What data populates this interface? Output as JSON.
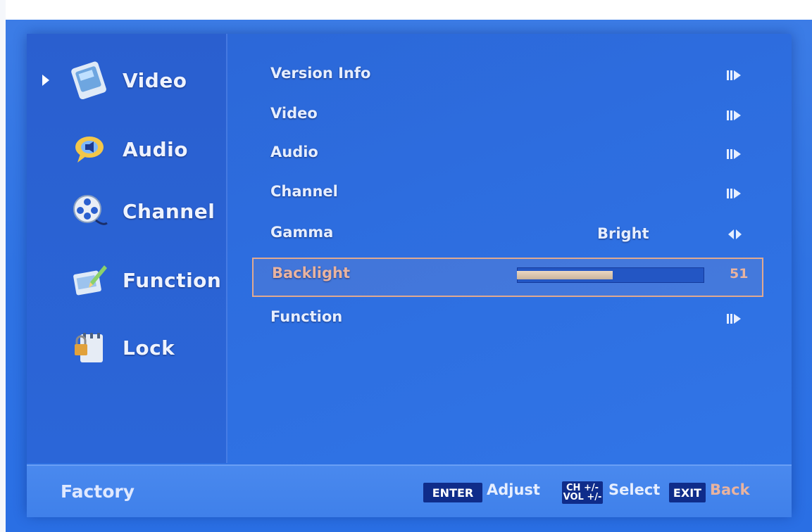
{
  "sidebar": {
    "items": [
      {
        "label": "Video",
        "icon": "video-icon",
        "selected": true
      },
      {
        "label": "Audio",
        "icon": "audio-icon",
        "selected": false
      },
      {
        "label": "Channel",
        "icon": "channel-icon",
        "selected": false
      },
      {
        "label": "Function",
        "icon": "function-icon",
        "selected": false
      },
      {
        "label": "Lock",
        "icon": "lock-icon",
        "selected": false
      }
    ]
  },
  "menu": {
    "items": [
      {
        "label": "Version Info",
        "value": "",
        "control": "submenu"
      },
      {
        "label": "Video",
        "value": "",
        "control": "submenu"
      },
      {
        "label": "Audio",
        "value": "",
        "control": "submenu"
      },
      {
        "label": "Channel",
        "value": "",
        "control": "submenu"
      },
      {
        "label": "Gamma",
        "value": "Bright",
        "control": "left-right"
      },
      {
        "label": "Backlight",
        "value": "51",
        "control": "slider",
        "level": 51,
        "max": 100
      },
      {
        "label": "Function",
        "value": "",
        "control": "submenu"
      }
    ],
    "selected_index": 5
  },
  "footer": {
    "title": "Factory",
    "keys": [
      {
        "key": "ENTER",
        "action": "Adjust"
      },
      {
        "key_line1": "CH +/-",
        "key_line2": "VOL +/-",
        "action": "Select"
      },
      {
        "key": "EXIT",
        "action": "Back"
      }
    ]
  },
  "colors": {
    "background": "#2f73e3",
    "highlight_border": "#e0a990",
    "key_bg": "#0f2c8a"
  }
}
